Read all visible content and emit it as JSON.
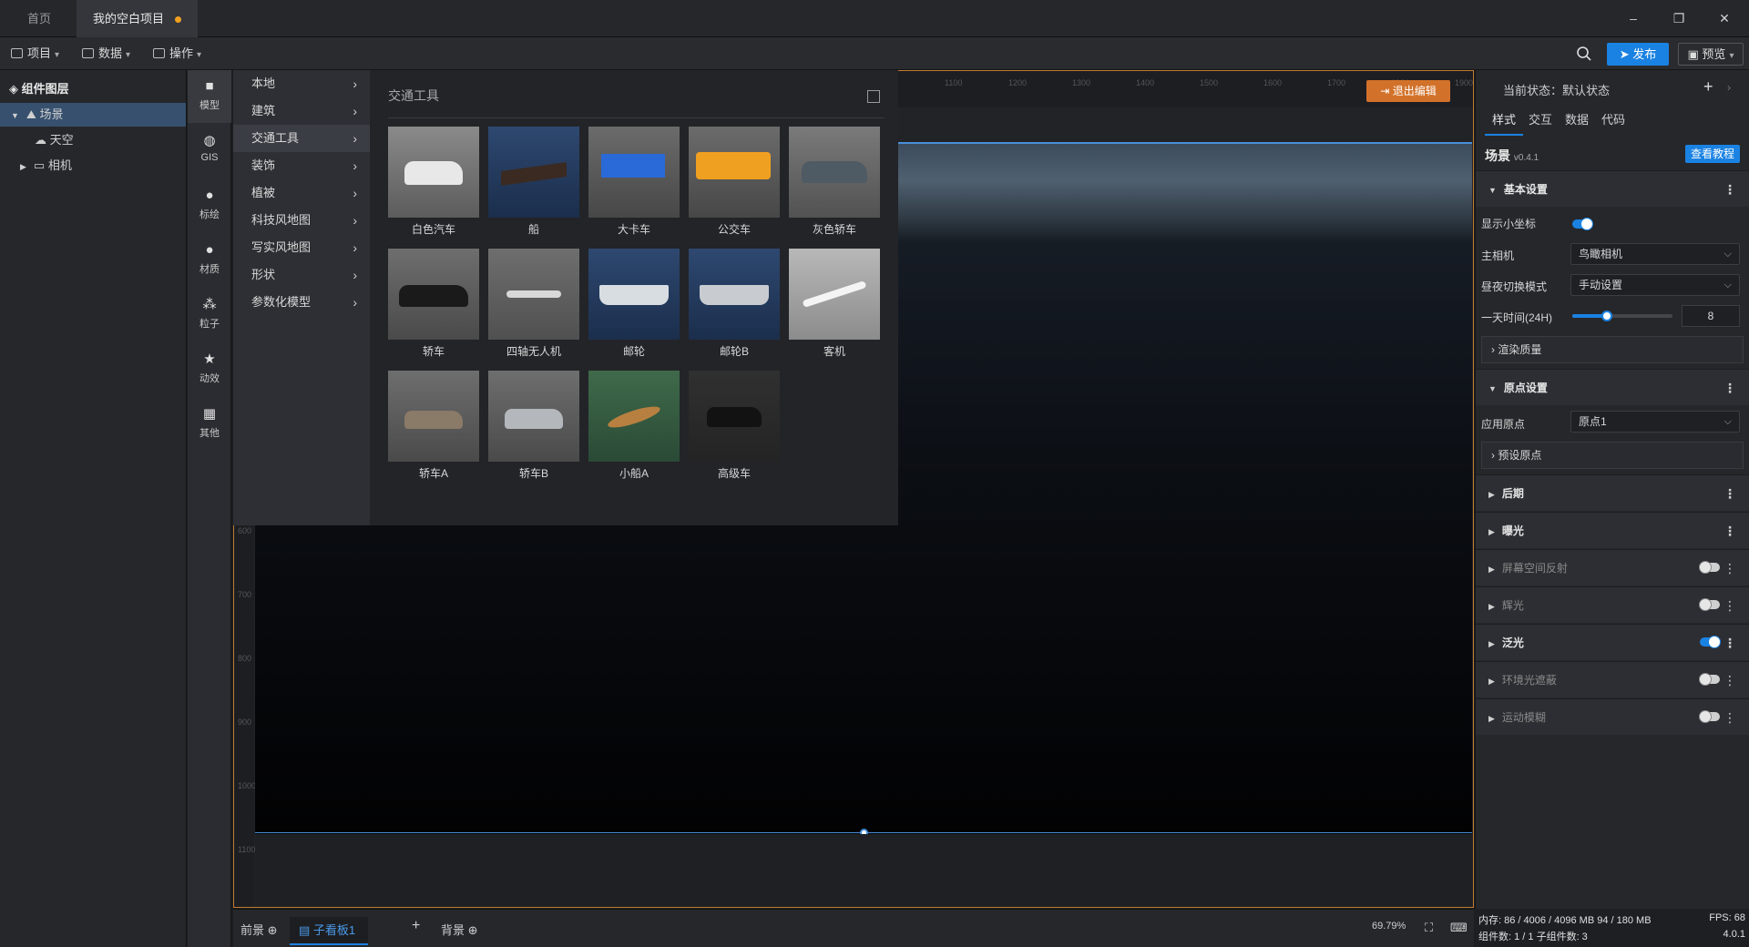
{
  "titlebar": {
    "tabs": [
      {
        "label": "首页"
      },
      {
        "label": "我的空白项目"
      }
    ],
    "window_buttons": {
      "minimize": "–",
      "restore": "❐",
      "close": "✕"
    }
  },
  "menubar": {
    "items": [
      {
        "label": "项目"
      },
      {
        "label": "数据"
      },
      {
        "label": "操作"
      }
    ],
    "publish_label": "发布",
    "preview_label": "预览"
  },
  "layers": {
    "title": "组件图层",
    "items": [
      {
        "label": "场景"
      },
      {
        "label": "天空"
      },
      {
        "label": "相机"
      }
    ]
  },
  "rail": {
    "items": [
      {
        "label": "模型",
        "icon": "cube-icon"
      },
      {
        "label": "GIS",
        "icon": "globe-icon"
      },
      {
        "label": "标绘",
        "icon": "pin-icon"
      },
      {
        "label": "材质",
        "icon": "sphere-icon"
      },
      {
        "label": "粒子",
        "icon": "particle-icon"
      },
      {
        "label": "动效",
        "icon": "star-icon"
      },
      {
        "label": "其他",
        "icon": "grid-icon"
      }
    ]
  },
  "categories": [
    {
      "label": "本地"
    },
    {
      "label": "建筑"
    },
    {
      "label": "交通工具"
    },
    {
      "label": "装饰"
    },
    {
      "label": "植被"
    },
    {
      "label": "科技风地图"
    },
    {
      "label": "写实风地图"
    },
    {
      "label": "形状"
    },
    {
      "label": "参数化模型"
    }
  ],
  "gallery": {
    "title": "交通工具",
    "items": [
      {
        "label": "白色汽车"
      },
      {
        "label": "船"
      },
      {
        "label": "大卡车"
      },
      {
        "label": "公交车"
      },
      {
        "label": "灰色轿车"
      },
      {
        "label": "轿车"
      },
      {
        "label": "四轴无人机"
      },
      {
        "label": "邮轮"
      },
      {
        "label": "邮轮B"
      },
      {
        "label": "客机"
      },
      {
        "label": "轿车A"
      },
      {
        "label": "轿车B"
      },
      {
        "label": "小船A"
      },
      {
        "label": "高级车"
      }
    ]
  },
  "canvas": {
    "exit_label": "退出编辑",
    "ruler_top": [
      "1100",
      "1200",
      "1300",
      "1400",
      "1500",
      "1600",
      "1700",
      "1800",
      "1900"
    ],
    "ruler_left": [
      "600",
      "700",
      "800",
      "900",
      "1000",
      "1100"
    ]
  },
  "bottombar": {
    "tabs": [
      {
        "label": "前景"
      },
      {
        "label": "子看板1"
      },
      {
        "label": "背景"
      }
    ],
    "zoom": "69.79%"
  },
  "props": {
    "state_label": "当前状态：默认状态",
    "tabs": [
      {
        "label": "样式"
      },
      {
        "label": "交互"
      },
      {
        "label": "数据"
      },
      {
        "label": "代码"
      }
    ],
    "component_name": "场景",
    "component_version": "v0.4.1",
    "tutorial_label": "查看教程",
    "basic_section": "基本设置",
    "show_axis_label": "显示小坐标",
    "main_camera_label": "主相机",
    "main_camera_value": "鸟瞰相机",
    "daynight_label": "昼夜切换模式",
    "daynight_value": "手动设置",
    "time_label": "一天时间(24H)",
    "time_value": "8",
    "render_quality": "渲染质量",
    "origin_section": "原点设置",
    "apply_origin_label": "应用原点",
    "apply_origin_value": "原点1",
    "preset_origin": "预设原点",
    "sections": [
      {
        "label": "后期"
      },
      {
        "label": "曝光"
      },
      {
        "label": "屏幕空间反射"
      },
      {
        "label": "辉光"
      },
      {
        "label": "泛光"
      },
      {
        "label": "环境光遮蔽"
      },
      {
        "label": "运动模糊"
      }
    ]
  },
  "status": {
    "memory": "内存: 86 / 4006 / 4096 MB  94 / 180 MB",
    "fps": "FPS: 68",
    "components": "组件数: 1 / 1   子组件数: 3",
    "version": "4.0.1"
  },
  "colors": {
    "accent": "#1a82e2",
    "exit_button": "#d2722a",
    "canvas_border": "#c07a30",
    "dirty_dot": "#f0a020"
  }
}
